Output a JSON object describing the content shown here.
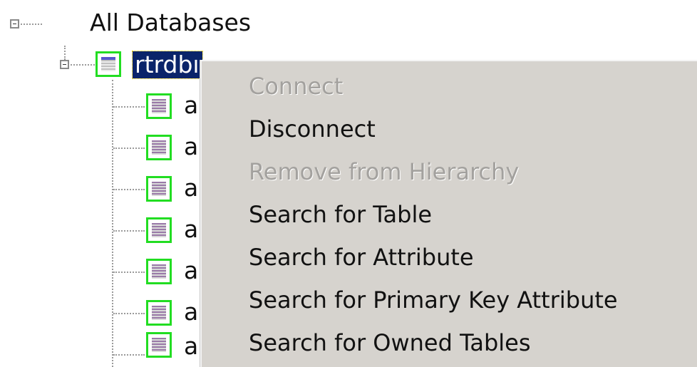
{
  "tree": {
    "root": {
      "label": "All Databases",
      "expanded": true
    },
    "server": {
      "label": "rtrdbı",
      "icon": "database-server-icon",
      "selected": true,
      "expanded": true
    },
    "children": [
      {
        "label": "a",
        "icon": "database-table-icon"
      },
      {
        "label": "a",
        "icon": "database-table-icon"
      },
      {
        "label": "a",
        "icon": "database-table-icon"
      },
      {
        "label": "a",
        "icon": "database-table-icon"
      },
      {
        "label": "a",
        "icon": "database-table-icon"
      },
      {
        "label": "a",
        "icon": "database-table-icon"
      },
      {
        "label": "a",
        "icon": "database-table-icon"
      }
    ]
  },
  "context_menu": {
    "items": [
      {
        "label": "Connect",
        "enabled": false
      },
      {
        "label": "Disconnect",
        "enabled": true
      },
      {
        "label": "Remove from Hierarchy",
        "enabled": false
      },
      {
        "label": "Search for Table",
        "enabled": true
      },
      {
        "label": "Search for Attribute",
        "enabled": true
      },
      {
        "label": "Search for Primary Key Attribute",
        "enabled": true
      },
      {
        "label": "Search for Owned Tables",
        "enabled": true
      }
    ]
  },
  "colors": {
    "selection_bg": "#0a246a",
    "menu_bg": "#d6d3ce",
    "icon_border": "#22dd22",
    "disabled_text": "#a3a19e"
  }
}
